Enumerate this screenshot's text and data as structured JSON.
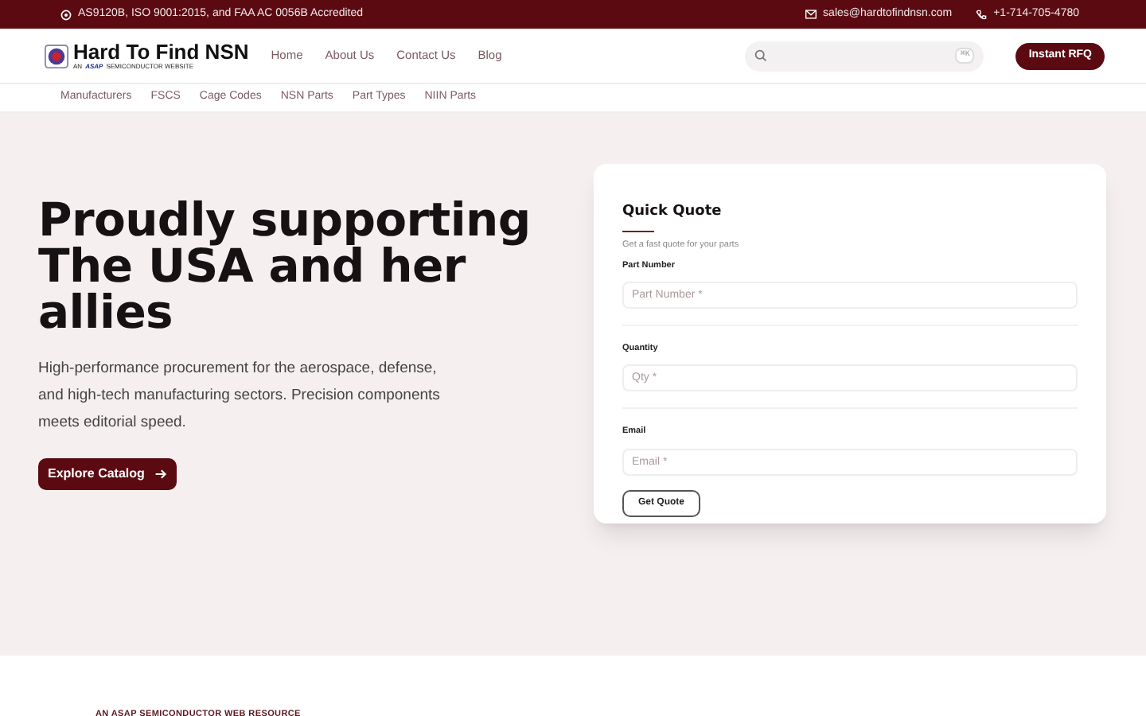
{
  "top_bar": {
    "accreditation": "AS9120B, ISO 9001:2015, and FAA AC 0056B Accredited",
    "email": "sales@hardtofindnsn.com",
    "phone": "+1-714-705-4780"
  },
  "header": {
    "logo_title": "Hard To Find NSN",
    "logo_prefix": "AN",
    "logo_brand": "ASAP",
    "logo_suffix": "SEMICONDUCTOR WEBSITE",
    "nav": [
      "Home",
      "About Us",
      "Contact Us",
      "Blog"
    ],
    "search": {
      "shortcut": "⌘K"
    },
    "cta": "Instant RFQ"
  },
  "sub_nav": [
    "Manufacturers",
    "FSCS",
    "Cage Codes",
    "NSN Parts",
    "Part Types",
    "NIIN Parts"
  ],
  "hero": {
    "heading": "Proudly supporting The USA and her allies",
    "text": "High-performance procurement for the aerospace, defense, and high-tech manufacturing sectors. Precision components meets editorial speed.",
    "button": "Explore Catalog"
  },
  "quote_form": {
    "title": "Quick Quote",
    "subtitle": "Get a fast quote for your parts",
    "fields": [
      {
        "label": "Part Number",
        "placeholder": "Part Number *"
      },
      {
        "label": "Quantity",
        "placeholder": "Qty *"
      },
      {
        "label": "Email",
        "placeholder": "Email *"
      }
    ],
    "submit": "Get Quote"
  },
  "next_section": {
    "eyebrow": "AN ASAP SEMICONDUCTOR WEB RESOURCE"
  }
}
